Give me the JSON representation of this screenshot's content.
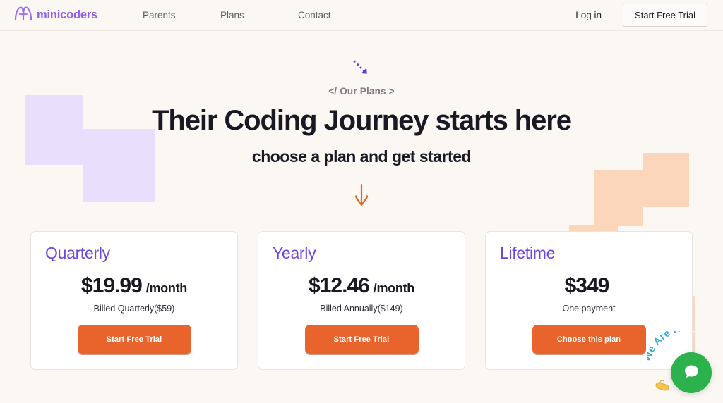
{
  "header": {
    "brand": {
      "name": "minicoders",
      "logo_icon": "minicoders-arches-logo",
      "color": "#8b5cf6"
    },
    "nav": [
      {
        "label": "Parents"
      },
      {
        "label": "Plans"
      },
      {
        "label": "Contact"
      }
    ],
    "login_label": "Log in",
    "trial_label": "Start Free Trial"
  },
  "hero": {
    "arrow_top_icon": "dotted-diagonal-arrow-down-right",
    "eyebrow": "</ Our Plans >",
    "title": "Their Coding Journey starts here",
    "subtitle": "choose a plan and get started",
    "arrow_bottom_icon": "arrow-down"
  },
  "plans": [
    {
      "name": "Quarterly",
      "price": "$19.99",
      "period": "/month",
      "billing": "Billed Quarterly($59)",
      "cta": "Start Free Trial"
    },
    {
      "name": "Yearly",
      "price": "$12.46",
      "period": "/month",
      "billing": "Billed Annually($149)",
      "cta": "Start Free Trial"
    },
    {
      "name": "Lifetime",
      "price": "$349",
      "period": "",
      "billing": "One payment",
      "cta": "Choose this plan"
    }
  ],
  "chat": {
    "badge_text": "We Are Here",
    "bubble_icon": "chat-bubble-icon",
    "hand_icon": "pointing-hand-icon",
    "bubble_color": "#2bb24c",
    "badge_color": "#3aa9c9"
  },
  "theme": {
    "background": "#fbf7f3",
    "accent_purple": "#6d46e0",
    "accent_orange": "#e9642c",
    "deco_purple": "#e7dffb",
    "deco_peach": "#fbd6bb"
  }
}
